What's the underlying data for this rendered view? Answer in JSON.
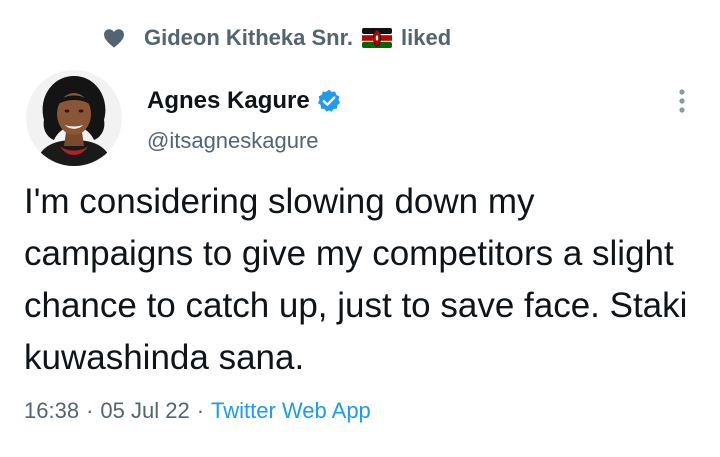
{
  "social_context": {
    "user": "Gideon Kitheka Snr.",
    "action": "liked",
    "icon": "heart-icon",
    "flag": "kenya-flag-icon"
  },
  "author": {
    "name": "Agnes Kagure",
    "handle": "@itsagneskagure",
    "verified": true
  },
  "tweet": {
    "text": "I'm considering slowing down my campaigns to give my competitors a slight chance to catch up, just to save face. Staki kuwashinda sana.",
    "time": "16:38",
    "date": "05 Jul 22",
    "source": "Twitter Web App",
    "separator": "·"
  },
  "colors": {
    "primary_text": "#0f1419",
    "secondary_text": "#536471",
    "accent": "#1d9bf0"
  }
}
